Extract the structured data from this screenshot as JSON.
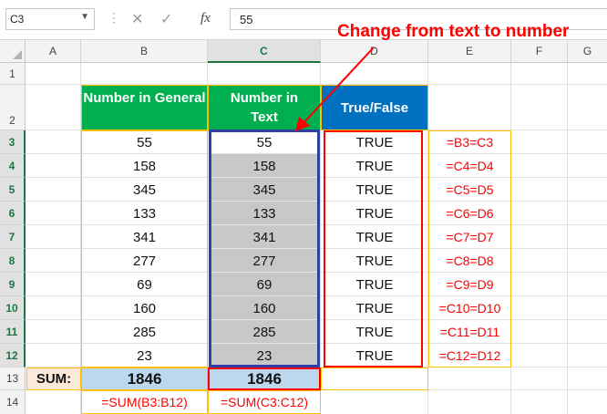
{
  "formula_bar": {
    "name_box": "C3",
    "cancel_icon": "✕",
    "enter_icon": "✓",
    "fx_icon": "fx",
    "value": "55"
  },
  "annotation": {
    "text": "Change from text to number",
    "color": "#ff0000"
  },
  "columns": [
    "A",
    "B",
    "C",
    "D",
    "E",
    "F",
    "G"
  ],
  "selected_column": "C",
  "rows": [
    "1",
    "2",
    "3",
    "4",
    "5",
    "6",
    "7",
    "8",
    "9",
    "10",
    "11",
    "12",
    "13",
    "14"
  ],
  "selected_row": "3",
  "table": {
    "header_b": "Number in General",
    "header_c": "Number in Text",
    "header_d": "True/False",
    "b_values": [
      "55",
      "158",
      "345",
      "133",
      "341",
      "277",
      "69",
      "160",
      "285",
      "23"
    ],
    "c_values": [
      "55",
      "158",
      "345",
      "133",
      "341",
      "277",
      "69",
      "160",
      "285",
      "23"
    ],
    "d_values": [
      "TRUE",
      "TRUE",
      "TRUE",
      "TRUE",
      "TRUE",
      "TRUE",
      "TRUE",
      "TRUE",
      "TRUE",
      "TRUE"
    ],
    "e_formulas": [
      "=B3=C3",
      "=C4=D4",
      "=C5=D5",
      "=C6=D6",
      "=C7=D7",
      "=C8=D8",
      "=C9=D9",
      "=C10=D10",
      "=C11=D11",
      "=C12=D12"
    ]
  },
  "sum_row": {
    "label": "SUM:",
    "b_total": "1846",
    "c_total": "1846",
    "b_formula": "=SUM(B3:B12)",
    "c_formula": "=SUM(C3:C12)"
  },
  "colors": {
    "header_green": "#00b050",
    "header_blue": "#0070c0",
    "sum_label_bg": "#fde9d9",
    "sum_value_bg": "#bdd7ee",
    "gray_cells": "#c8c8c8",
    "red": "#ff0000",
    "selection_blue": "#2f3fa8",
    "border_yellow": "#ffc000"
  }
}
